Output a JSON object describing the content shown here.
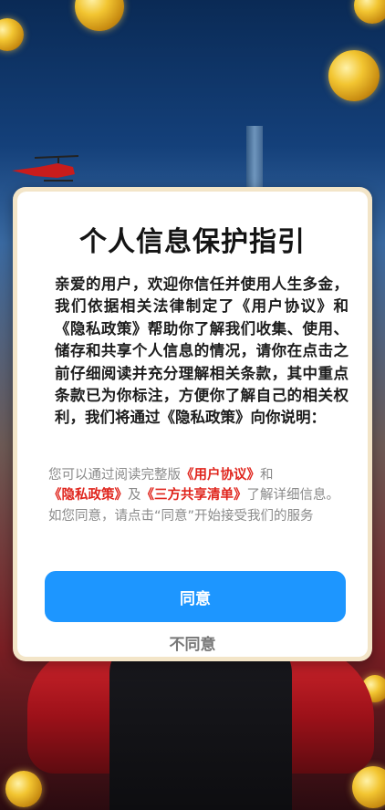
{
  "dialog": {
    "title": "个人信息保护指引",
    "body": "亲爱的用户，欢迎你信任并使用人生多金，我们依据相关法律制定了《用户协议》和《隐私政策》帮助你了解我们收集、使用、储存和共享个人信息的情况，请你在点击之前仔细阅读并充分理解相关条款，其中重点条款已为你标注，方便你了解自己的相关权利，我们将通过《隐私政策》向你说明：",
    "note_prefix": "您可以通过阅读完整版",
    "link_user_agreement": "《用户协议》",
    "note_and": "和",
    "link_privacy_policy": "《隐私政策》",
    "note_ji": "及",
    "link_third_party": "《三方共享清单》",
    "note_suffix": "了解详细信息。如您同意，请点击“同意”开始接受我们的服务",
    "agree_label": "同意",
    "disagree_label": "不同意"
  },
  "colors": {
    "accent_button": "#1d96ff",
    "link_red": "#e0251d",
    "frame_cream": "#f3e5c8"
  }
}
